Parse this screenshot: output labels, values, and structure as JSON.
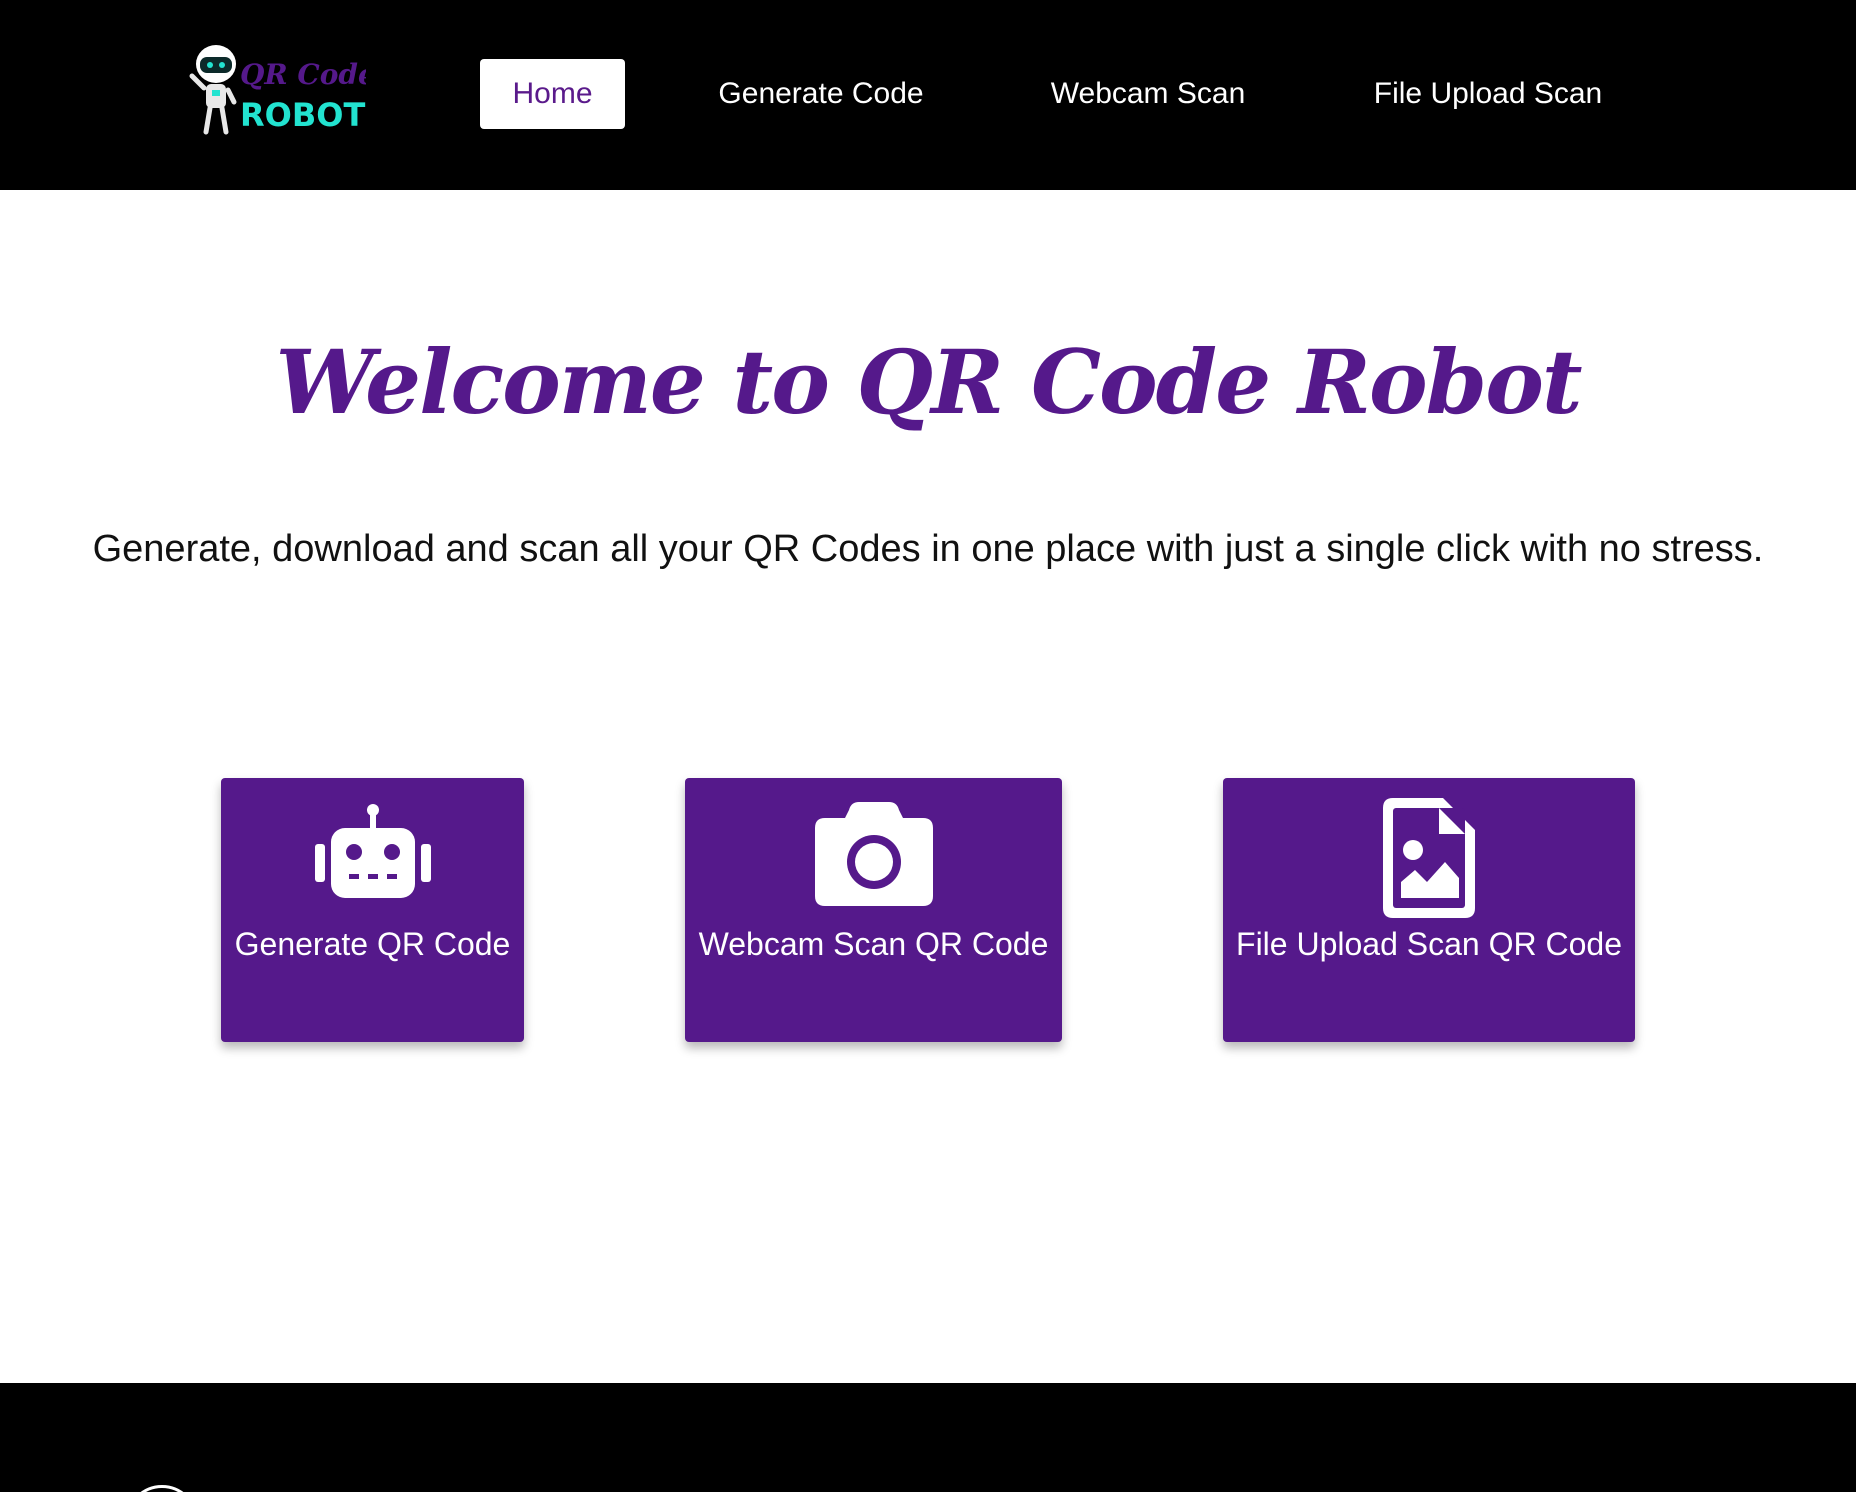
{
  "header": {
    "logo": {
      "line1": "QR Code",
      "line2": "ROBOT",
      "line1_color": "#55198b",
      "line2_color": "#22e3d0"
    },
    "nav": [
      {
        "label": "Home",
        "active": true
      },
      {
        "label": "Generate Code",
        "active": false
      },
      {
        "label": "Webcam Scan",
        "active": false
      },
      {
        "label": "File Upload Scan",
        "active": false
      }
    ]
  },
  "hero": {
    "title": "Welcome to QR Code Robot",
    "subtitle": "Generate, download and scan all your QR Codes in one place with just a single click with no stress."
  },
  "cards": [
    {
      "label": "Generate QR Code",
      "icon": "robot-icon"
    },
    {
      "label": "Webcam Scan QR Code",
      "icon": "camera-icon"
    },
    {
      "label": "File Upload Scan QR Code",
      "icon": "file-image-icon"
    }
  ],
  "colors": {
    "brand": "#55198b",
    "header_bg": "#000000",
    "accent": "#22e3d0"
  }
}
